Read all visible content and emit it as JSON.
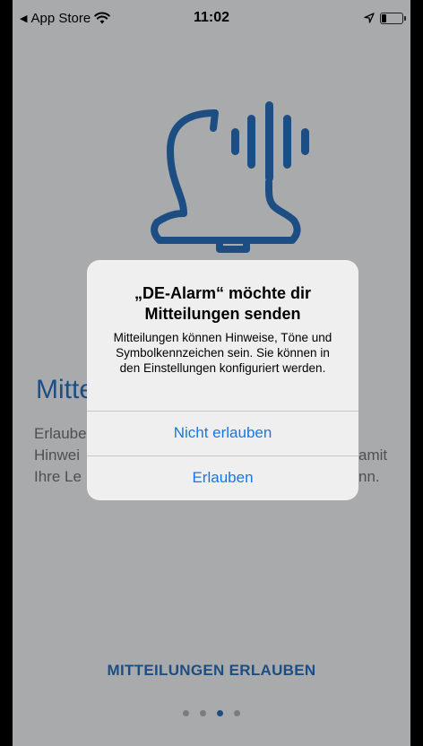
{
  "status_bar": {
    "back_label": "App Store",
    "time": "11:02"
  },
  "background": {
    "title": "Mitte",
    "body_lines": [
      "Erlaube",
      "Hinwei",
      "Ihre Le"
    ],
    "body_right_lines": [
      "amit",
      "nn."
    ],
    "cta_button": "MITTEILUNGEN ERLAUBEN",
    "page_count": 4,
    "active_page": 3,
    "accent_color": "#1d4e83"
  },
  "alert": {
    "title": "„DE-Alarm“ möchte dir Mitteilungen senden",
    "message": "Mitteilungen können Hinweise, Töne und Symbolkennzeichen sein. Sie können in den Einstellungen konfiguriert werden.",
    "deny_label": "Nicht erlauben",
    "allow_label": "Erlauben",
    "button_color": "#1877e6"
  }
}
